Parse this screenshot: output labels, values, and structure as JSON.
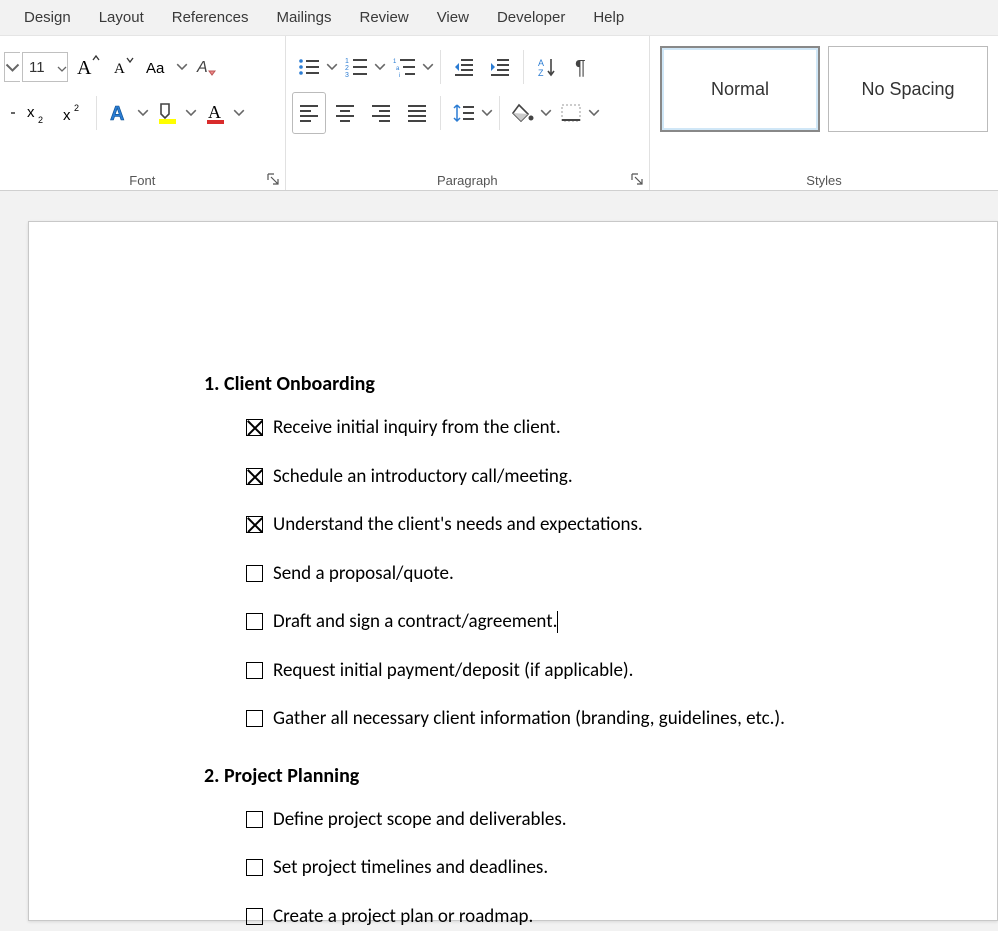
{
  "tabs": [
    "Design",
    "Layout",
    "References",
    "Mailings",
    "Review",
    "View",
    "Developer",
    "Help"
  ],
  "ribbon": {
    "fontSize": "11",
    "groupLabels": {
      "font": "Font",
      "paragraph": "Paragraph",
      "styles": "Styles"
    },
    "styleItems": [
      {
        "name": "Normal",
        "selected": true
      },
      {
        "name": "No Spacing",
        "selected": false
      }
    ]
  },
  "document": {
    "sections": [
      {
        "number": "1.",
        "title": "Client Onboarding",
        "items": [
          {
            "checked": true,
            "text": "Receive initial inquiry from the client.",
            "cursor": false
          },
          {
            "checked": true,
            "text": "Schedule an introductory call/meeting.",
            "cursor": false
          },
          {
            "checked": true,
            "text": "Understand the client's needs and expectations.",
            "cursor": false
          },
          {
            "checked": false,
            "text": "Send a proposal/quote.",
            "cursor": false
          },
          {
            "checked": false,
            "text": "Draft and sign a contract/agreement.",
            "cursor": true
          },
          {
            "checked": false,
            "text": "Request initial payment/deposit (if applicable).",
            "cursor": false
          },
          {
            "checked": false,
            "text": "Gather all necessary client information (branding, guidelines, etc.).",
            "cursor": false
          }
        ]
      },
      {
        "number": "2.",
        "title": "Project Planning",
        "items": [
          {
            "checked": false,
            "text": "Define project scope and deliverables.",
            "cursor": false
          },
          {
            "checked": false,
            "text": "Set project timelines and deadlines.",
            "cursor": false
          },
          {
            "checked": false,
            "text": "Create a project plan or roadmap.",
            "cursor": false
          }
        ]
      }
    ]
  }
}
